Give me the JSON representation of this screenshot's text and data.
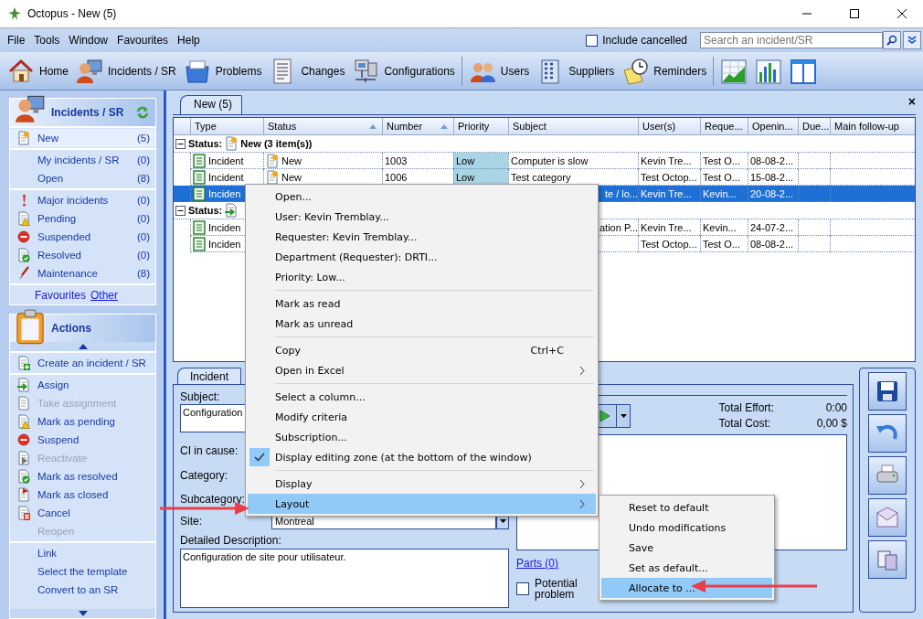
{
  "window": {
    "title": "Octopus - New (5)"
  },
  "menu_bar": [
    "File",
    "Tools",
    "Window",
    "Favourites",
    "Help"
  ],
  "include_cancelled": {
    "label": "Include cancelled",
    "checked": false
  },
  "search": {
    "placeholder": "Search an incident/SR"
  },
  "toolbar": [
    {
      "label": "Home",
      "kind": "home"
    },
    {
      "label": "Incidents / SR",
      "kind": "incidents"
    },
    {
      "label": "Problems",
      "kind": "problems"
    },
    {
      "label": "Changes",
      "kind": "changes"
    },
    {
      "label": "Configurations",
      "kind": "configurations"
    },
    {
      "label": "Users",
      "kind": "users"
    },
    {
      "label": "Suppliers",
      "kind": "suppliers"
    },
    {
      "label": "Reminders",
      "kind": "reminders"
    },
    {
      "kind": "line-chart"
    },
    {
      "kind": "bar-chart"
    },
    {
      "kind": "columns"
    }
  ],
  "incidents_panel": {
    "title": "Incidents / SR",
    "sections": [
      [
        {
          "label": "New",
          "count": "(5)",
          "kind": "new",
          "selected": true
        }
      ],
      [
        {
          "label": "My incidents / SR",
          "count": "(0)",
          "kind": "none",
          "selected": false
        },
        {
          "label": "Open",
          "count": "(8)",
          "kind": "none",
          "selected": false
        }
      ],
      [
        {
          "label": "Major incidents",
          "count": "(0)",
          "kind": "major",
          "selected": false
        },
        {
          "label": "Pending",
          "count": "(0)",
          "kind": "pending",
          "selected": false
        },
        {
          "label": "Suspended",
          "count": "(0)",
          "kind": "suspended",
          "selected": false
        },
        {
          "label": "Resolved",
          "count": "(0)",
          "kind": "resolved",
          "selected": false
        },
        {
          "label": "Maintenance",
          "count": "(8)",
          "kind": "maintenance",
          "selected": false
        }
      ]
    ],
    "favourites": "Favourites",
    "other": "Other"
  },
  "actions_panel": {
    "title": "Actions",
    "sections": [
      [
        {
          "label": "Create an incident / SR",
          "kind": "create",
          "disabled": false
        }
      ],
      [
        {
          "label": "Assign",
          "kind": "assign",
          "disabled": false
        },
        {
          "label": "Take assignment",
          "kind": "plain",
          "disabled": true
        },
        {
          "label": "Mark as pending",
          "kind": "pending",
          "disabled": false
        },
        {
          "label": "Suspend",
          "kind": "suspended",
          "disabled": false
        },
        {
          "label": "Reactivate",
          "kind": "reactivate",
          "disabled": true
        },
        {
          "label": "Mark as resolved",
          "kind": "resolved",
          "disabled": false
        },
        {
          "label": "Mark as closed",
          "kind": "closed",
          "disabled": false
        },
        {
          "label": "Cancel",
          "kind": "cancel",
          "disabled": false
        },
        {
          "label": "Reopen",
          "kind": "none",
          "disabled": true
        }
      ],
      [
        {
          "label": "Link",
          "kind": "none",
          "disabled": false
        },
        {
          "label": "Select the template",
          "kind": "none",
          "disabled": false
        },
        {
          "label": "Convert to an SR",
          "kind": "none",
          "disabled": false
        }
      ]
    ]
  },
  "tab": {
    "label": "New (5)",
    "close": "×"
  },
  "table": {
    "columns": [
      {
        "label": "Type"
      },
      {
        "label": "Status",
        "sorted": true
      },
      {
        "label": "Number",
        "sorted": true
      },
      {
        "label": "Priority"
      },
      {
        "label": "Subject"
      },
      {
        "label": "User(s)"
      },
      {
        "label": "Reque..."
      },
      {
        "label": "Openin..."
      },
      {
        "label": "Due..."
      },
      {
        "label": "Main follow-up"
      }
    ],
    "groups": [
      {
        "label": "Status:",
        "title": "New (3 item(s))",
        "kind": "new",
        "expanded": true,
        "rows": [
          {
            "type": "Incident",
            "status": "New",
            "number": "1003",
            "priority": "Low",
            "subject": "Computer is slow",
            "users": "Kevin Tre...",
            "requester": "Test O...",
            "opening": "08-08-2...",
            "selected": false
          },
          {
            "type": "Incident",
            "status": "New",
            "number": "1006",
            "priority": "Low",
            "subject": "Test category",
            "users": "Test Octop...",
            "requester": "Test O...",
            "opening": "15-08-2...",
            "selected": false
          },
          {
            "type": "Inciden",
            "subject": "te / lo...",
            "subject_cut": true,
            "users": "Kevin Tre...",
            "requester": "Kevin...",
            "opening": "20-08-2...",
            "selected": true
          }
        ]
      },
      {
        "label": "Status:",
        "kind": "assign",
        "expanded": true,
        "rows": [
          {
            "type": "Inciden",
            "subject": "ation P...",
            "subject_cut": true,
            "users": "Kevin Tre...",
            "requester": "Kevin...",
            "opening": "24-07-2...",
            "selected": false
          },
          {
            "type": "Inciden",
            "users": "Test Octop...",
            "requester": "Test O...",
            "opening": "08-08-2...",
            "selected": false
          }
        ]
      }
    ]
  },
  "editor": {
    "tab": "Incident",
    "subject": {
      "label": "Subject:",
      "value": "Configuration"
    },
    "labels": [
      "CI in cause:",
      "Category:",
      "Subcategory:"
    ],
    "site": {
      "label": "Site:",
      "value": "Montreal"
    },
    "description": {
      "label": "Detailed Description:",
      "value": "Configuration de site pour utilisateur."
    },
    "total_effort": {
      "label": "Total Effort:",
      "value": "0:00"
    },
    "total_cost": {
      "label": "Total Cost:",
      "value": "0,00 $"
    },
    "parts_link": "Parts (0)",
    "potential_problem": {
      "label": "Potential problem",
      "checked": false
    }
  },
  "side_buttons": [
    {
      "kind": "save"
    },
    {
      "kind": "undo"
    },
    {
      "kind": "print"
    },
    {
      "kind": "mail"
    },
    {
      "kind": "copy"
    }
  ],
  "context_menu": {
    "sections": [
      [
        {
          "label": "Open...",
          "checked": false,
          "selected": false
        },
        {
          "label": "User: Kevin Tremblay...",
          "checked": false,
          "selected": false
        },
        {
          "label": "Requester: Kevin Tremblay...",
          "checked": false,
          "selected": false
        },
        {
          "label": "Department (Requester): DRTI...",
          "checked": false,
          "selected": false
        },
        {
          "label": "Priority: Low...",
          "checked": false,
          "selected": false
        }
      ],
      [
        {
          "label": "Mark as read",
          "checked": false,
          "selected": false
        },
        {
          "label": "Mark as unread",
          "checked": false,
          "selected": false
        }
      ],
      [
        {
          "label": "Copy",
          "shortcut": "Ctrl+C",
          "checked": false,
          "selected": false
        },
        {
          "label": "Open in Excel",
          "submenu": true,
          "checked": false,
          "selected": false
        }
      ],
      [
        {
          "label": "Select a column...",
          "checked": false,
          "selected": false
        },
        {
          "label": "Modify criteria",
          "checked": false,
          "selected": false
        },
        {
          "label": "Subscription...",
          "checked": false,
          "selected": false
        },
        {
          "label": "Display editing zone (at the bottom of the window)",
          "checked": true,
          "selected": false
        }
      ],
      [
        {
          "label": "Display",
          "submenu": true,
          "checked": false,
          "selected": false
        },
        {
          "label": "Layout",
          "submenu": true,
          "checked": false,
          "selected": true
        }
      ]
    ]
  },
  "submenu": [
    {
      "label": "Reset to default",
      "selected": false
    },
    {
      "label": "Undo modifications",
      "selected": false
    },
    {
      "label": "Save",
      "selected": false
    },
    {
      "label": "Set as default...",
      "selected": false
    },
    {
      "label": "Allocate to ...",
      "selected": true
    }
  ]
}
